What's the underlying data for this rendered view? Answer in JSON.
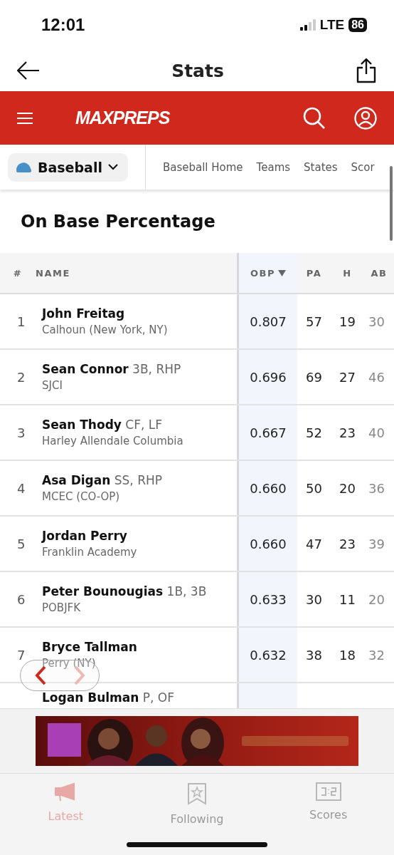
{
  "status_bar": {
    "time": "12:01",
    "network": "LTE",
    "battery": "86"
  },
  "header": {
    "title": "Stats"
  },
  "brand_bar": {
    "logo": "MAXPREPS"
  },
  "sport_selector": {
    "label": "Baseball"
  },
  "nav_links": [
    "Baseball Home",
    "Teams",
    "States",
    "Scor"
  ],
  "section_title": "On Base Percentage",
  "table": {
    "columns": [
      {
        "label": "#",
        "sorted": false
      },
      {
        "label": "NAME",
        "sorted": false
      },
      {
        "label": "OBP",
        "sorted": true
      },
      {
        "label": "PA",
        "sorted": false
      },
      {
        "label": "H",
        "sorted": false
      },
      {
        "label": "AB",
        "sorted": false
      }
    ],
    "rows": [
      {
        "rank": "1",
        "name": "John Freitag",
        "school": "Calhoun (New York, NY)",
        "obp": "0.807",
        "pa": "57",
        "h": "19",
        "ab": "30"
      },
      {
        "rank": "2",
        "name": "Sean Connor",
        "positions": "3B, RHP",
        "school": "SJCI",
        "obp": "0.696",
        "pa": "69",
        "h": "27",
        "ab": "46"
      },
      {
        "rank": "3",
        "name": "Sean Thody",
        "positions": "CF, LF",
        "school": "Harley Allendale Columbia",
        "obp": "0.667",
        "pa": "52",
        "h": "23",
        "ab": "40"
      },
      {
        "rank": "4",
        "name": "Asa Digan",
        "positions": "SS, RHP",
        "school": "MCEC (CO-OP)",
        "obp": "0.660",
        "pa": "50",
        "h": "20",
        "ab": "36"
      },
      {
        "rank": "5",
        "name": "Jordan Perry",
        "school": "Franklin Academy",
        "obp": "0.660",
        "pa": "47",
        "h": "23",
        "ab": "39"
      },
      {
        "rank": "6",
        "name": "Peter Bounougias",
        "positions": "1B, 3B",
        "school": "POBJFK",
        "obp": "0.633",
        "pa": "30",
        "h": "11",
        "ab": "20"
      },
      {
        "rank": "7",
        "name": "Bryce Tallman",
        "school": "Perry (NY)",
        "obp": "0.632",
        "pa": "38",
        "h": "18",
        "ab": "32"
      },
      {
        "name": "Logan Bulman",
        "positions": "P, OF"
      }
    ]
  },
  "pager": {
    "back_disabled": false,
    "forward_disabled": true
  },
  "tab_bar": [
    {
      "label": "Latest",
      "selected": true
    },
    {
      "label": "Following",
      "selected": false
    },
    {
      "label": "Scores",
      "selected": false
    }
  ]
}
